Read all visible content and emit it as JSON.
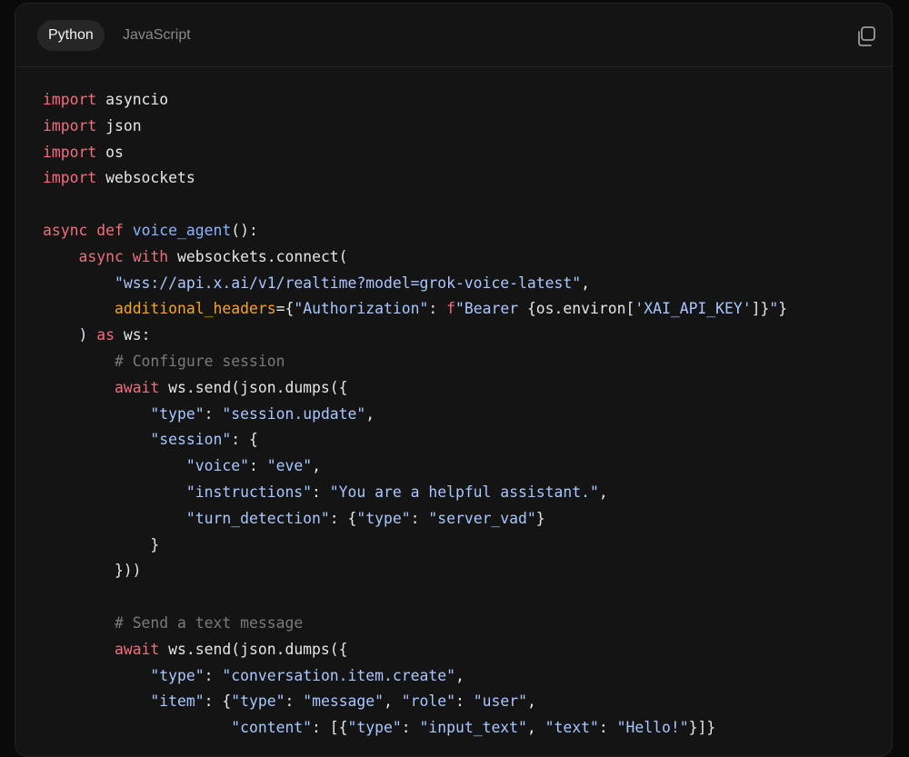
{
  "tabs": [
    {
      "label": "Python",
      "active": true
    },
    {
      "label": "JavaScript",
      "active": false
    }
  ],
  "copy_icon": "copy-icon",
  "colors": {
    "background": "#141414",
    "keyword": "#f26d7d",
    "function": "#8ab4ff",
    "string": "#a8c7ff",
    "comment": "#7a7a7a",
    "parameter": "#f5a524"
  },
  "code_lines": [
    [
      {
        "t": "kw",
        "v": "import"
      },
      {
        "t": "pl",
        "v": " asyncio"
      }
    ],
    [
      {
        "t": "kw",
        "v": "import"
      },
      {
        "t": "pl",
        "v": " json"
      }
    ],
    [
      {
        "t": "kw",
        "v": "import"
      },
      {
        "t": "pl",
        "v": " os"
      }
    ],
    [
      {
        "t": "kw",
        "v": "import"
      },
      {
        "t": "pl",
        "v": " websockets"
      }
    ],
    [],
    [
      {
        "t": "kw",
        "v": "async"
      },
      {
        "t": "pl",
        "v": " "
      },
      {
        "t": "kw",
        "v": "def"
      },
      {
        "t": "pl",
        "v": " "
      },
      {
        "t": "fn",
        "v": "voice_agent"
      },
      {
        "t": "pl",
        "v": "():"
      }
    ],
    [
      {
        "t": "pl",
        "v": "    "
      },
      {
        "t": "kw",
        "v": "async"
      },
      {
        "t": "pl",
        "v": " "
      },
      {
        "t": "kw",
        "v": "with"
      },
      {
        "t": "pl",
        "v": " websockets.connect("
      }
    ],
    [
      {
        "t": "pl",
        "v": "        "
      },
      {
        "t": "str",
        "v": "\"wss://api.x.ai/v1/realtime?model=grok-voice-latest\""
      },
      {
        "t": "pl",
        "v": ","
      }
    ],
    [
      {
        "t": "pl",
        "v": "        "
      },
      {
        "t": "param",
        "v": "additional_headers"
      },
      {
        "t": "pl",
        "v": "={"
      },
      {
        "t": "str",
        "v": "\"Authorization\""
      },
      {
        "t": "pl",
        "v": ": "
      },
      {
        "t": "fpre",
        "v": "f"
      },
      {
        "t": "str",
        "v": "\"Bearer "
      },
      {
        "t": "pl",
        "v": "{os.environ["
      },
      {
        "t": "str",
        "v": "'XAI_API_KEY'"
      },
      {
        "t": "pl",
        "v": "]}"
      },
      {
        "t": "str",
        "v": "\""
      },
      {
        "t": "pl",
        "v": "}"
      }
    ],
    [
      {
        "t": "pl",
        "v": "    ) "
      },
      {
        "t": "kw",
        "v": "as"
      },
      {
        "t": "pl",
        "v": " ws:"
      }
    ],
    [
      {
        "t": "pl",
        "v": "        "
      },
      {
        "t": "cm",
        "v": "# Configure session"
      }
    ],
    [
      {
        "t": "pl",
        "v": "        "
      },
      {
        "t": "kw",
        "v": "await"
      },
      {
        "t": "pl",
        "v": " ws.send(json.dumps({"
      }
    ],
    [
      {
        "t": "pl",
        "v": "            "
      },
      {
        "t": "key",
        "v": "\"type\""
      },
      {
        "t": "pl",
        "v": ": "
      },
      {
        "t": "str",
        "v": "\"session.update\""
      },
      {
        "t": "pl",
        "v": ","
      }
    ],
    [
      {
        "t": "pl",
        "v": "            "
      },
      {
        "t": "key",
        "v": "\"session\""
      },
      {
        "t": "pl",
        "v": ": {"
      }
    ],
    [
      {
        "t": "pl",
        "v": "                "
      },
      {
        "t": "key",
        "v": "\"voice\""
      },
      {
        "t": "pl",
        "v": ": "
      },
      {
        "t": "str",
        "v": "\"eve\""
      },
      {
        "t": "pl",
        "v": ","
      }
    ],
    [
      {
        "t": "pl",
        "v": "                "
      },
      {
        "t": "key",
        "v": "\"instructions\""
      },
      {
        "t": "pl",
        "v": ": "
      },
      {
        "t": "str",
        "v": "\"You are a helpful assistant.\""
      },
      {
        "t": "pl",
        "v": ","
      }
    ],
    [
      {
        "t": "pl",
        "v": "                "
      },
      {
        "t": "key",
        "v": "\"turn_detection\""
      },
      {
        "t": "pl",
        "v": ": {"
      },
      {
        "t": "key",
        "v": "\"type\""
      },
      {
        "t": "pl",
        "v": ": "
      },
      {
        "t": "str",
        "v": "\"server_vad\""
      },
      {
        "t": "pl",
        "v": "}"
      }
    ],
    [
      {
        "t": "pl",
        "v": "            }"
      }
    ],
    [
      {
        "t": "pl",
        "v": "        }))"
      }
    ],
    [],
    [
      {
        "t": "pl",
        "v": "        "
      },
      {
        "t": "cm",
        "v": "# Send a text message"
      }
    ],
    [
      {
        "t": "pl",
        "v": "        "
      },
      {
        "t": "kw",
        "v": "await"
      },
      {
        "t": "pl",
        "v": " ws.send(json.dumps({"
      }
    ],
    [
      {
        "t": "pl",
        "v": "            "
      },
      {
        "t": "key",
        "v": "\"type\""
      },
      {
        "t": "pl",
        "v": ": "
      },
      {
        "t": "str",
        "v": "\"conversation.item.create\""
      },
      {
        "t": "pl",
        "v": ","
      }
    ],
    [
      {
        "t": "pl",
        "v": "            "
      },
      {
        "t": "key",
        "v": "\"item\""
      },
      {
        "t": "pl",
        "v": ": {"
      },
      {
        "t": "key",
        "v": "\"type\""
      },
      {
        "t": "pl",
        "v": ": "
      },
      {
        "t": "str",
        "v": "\"message\""
      },
      {
        "t": "pl",
        "v": ", "
      },
      {
        "t": "key",
        "v": "\"role\""
      },
      {
        "t": "pl",
        "v": ": "
      },
      {
        "t": "str",
        "v": "\"user\""
      },
      {
        "t": "pl",
        "v": ","
      }
    ],
    [
      {
        "t": "pl",
        "v": "                     "
      },
      {
        "t": "key",
        "v": "\"content\""
      },
      {
        "t": "pl",
        "v": ": [{"
      },
      {
        "t": "key",
        "v": "\"type\""
      },
      {
        "t": "pl",
        "v": ": "
      },
      {
        "t": "str",
        "v": "\"input_text\""
      },
      {
        "t": "pl",
        "v": ", "
      },
      {
        "t": "key",
        "v": "\"text\""
      },
      {
        "t": "pl",
        "v": ": "
      },
      {
        "t": "str",
        "v": "\"Hello!\""
      },
      {
        "t": "pl",
        "v": "}]}"
      }
    ]
  ]
}
